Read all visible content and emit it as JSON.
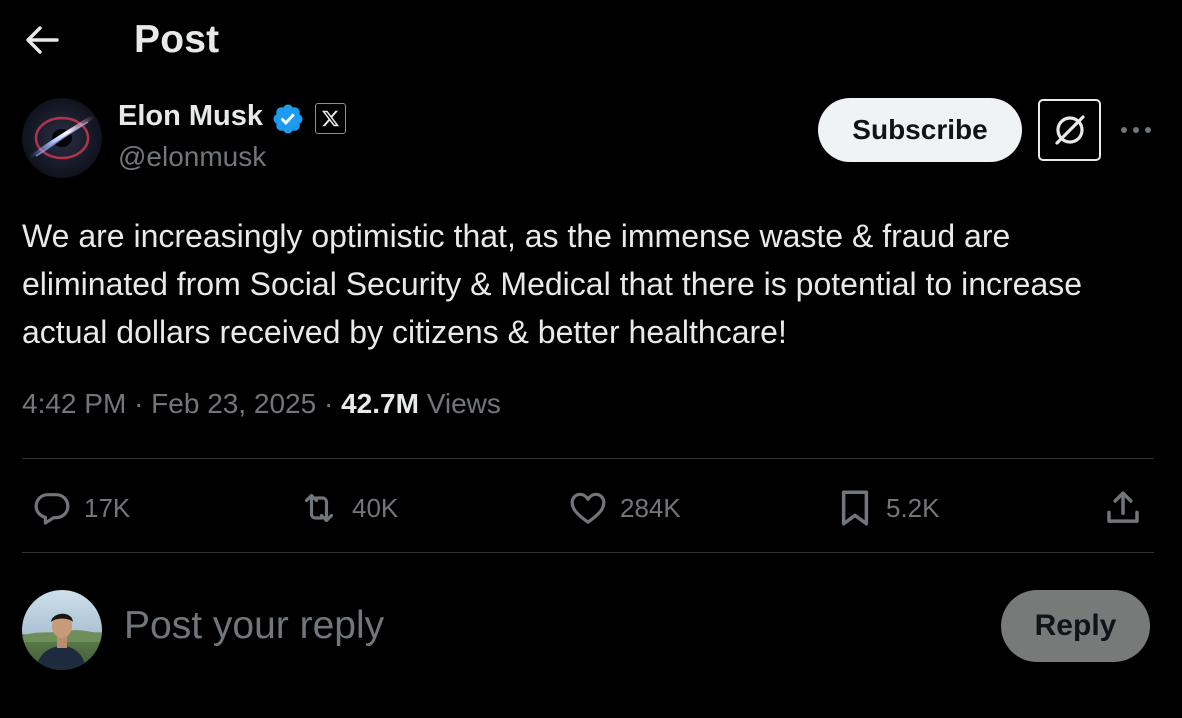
{
  "header": {
    "title": "Post",
    "back_icon": "arrow-left-icon"
  },
  "author": {
    "name": "Elon Musk",
    "handle": "@elonmusk",
    "verified_color": "#1d9bf0",
    "affiliate_badge": "x-logo-icon"
  },
  "actions_top": {
    "subscribe_label": "Subscribe",
    "grok_icon": "grok-icon",
    "more_icon": "more-horizontal-icon"
  },
  "post": {
    "text": "We are increasingly optimistic that, as the immense waste & fraud are eliminated from Social Security & Medical that there is potential to increase actual dollars received by citizens & better healthcare!",
    "time": "4:42 PM",
    "separator": "·",
    "date": "Feb 23, 2025",
    "views_count": "42.7M",
    "views_label": "Views"
  },
  "engagement": {
    "replies": "17K",
    "reposts": "40K",
    "likes": "284K",
    "bookmarks": "5.2K"
  },
  "composer": {
    "placeholder": "Post your reply",
    "reply_label": "Reply"
  },
  "colors": {
    "background": "#000000",
    "primary_text": "#e7e9ea",
    "secondary_text": "#71767b",
    "divider": "#2f3336",
    "reply_button_bg": "#787a7a"
  }
}
